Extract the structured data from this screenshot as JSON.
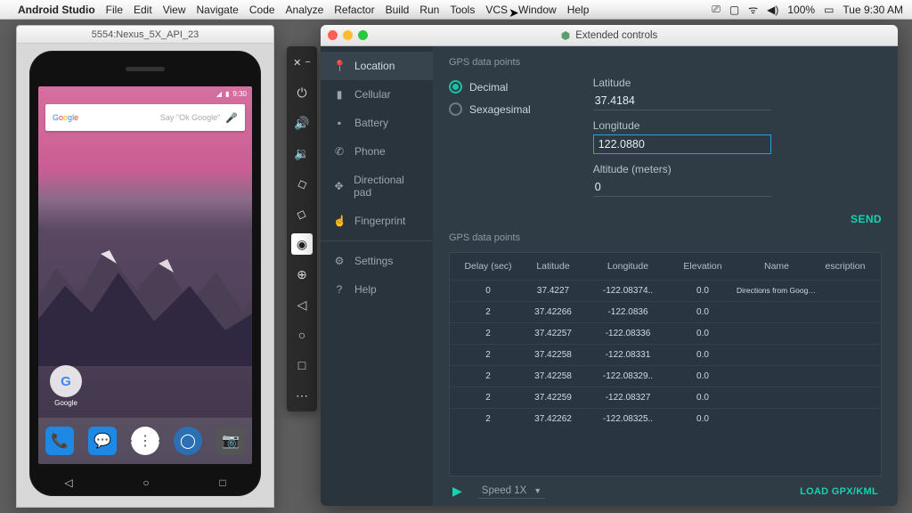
{
  "menubar": {
    "app": "Android Studio",
    "items": [
      "File",
      "Edit",
      "View",
      "Navigate",
      "Code",
      "Analyze",
      "Refactor",
      "Build",
      "Run",
      "Tools",
      "VCS",
      "Window",
      "Help"
    ],
    "battery": "100%",
    "clock": "Tue 9:30 AM"
  },
  "emulator": {
    "title": "5554:Nexus_5X_API_23",
    "status_time": "9:30",
    "search_logo": "Google",
    "search_placeholder": "Say \"Ok Google\"",
    "folder_label": "Google"
  },
  "toolbar_icons": [
    "close-minimize",
    "power",
    "volume-up",
    "volume-down",
    "rotate-left",
    "rotate-right",
    "camera",
    "zoom",
    "back",
    "home",
    "overview",
    "more"
  ],
  "ext": {
    "title": "Extended controls",
    "nav": [
      {
        "icon": "📍",
        "label": "Location",
        "selected": true
      },
      {
        "icon": "▮",
        "label": "Cellular"
      },
      {
        "icon": "▪",
        "label": "Battery"
      },
      {
        "icon": "✆",
        "label": "Phone"
      },
      {
        "icon": "✥",
        "label": "Directional pad"
      },
      {
        "icon": "☝",
        "label": "Fingerprint"
      },
      {
        "sep": true
      },
      {
        "icon": "⚙",
        "label": "Settings"
      },
      {
        "icon": "?",
        "label": "Help"
      }
    ],
    "section1": "GPS data points",
    "radio_decimal": "Decimal",
    "radio_sexagesimal": "Sexagesimal",
    "lat_label": "Latitude",
    "lat_value": "37.4184",
    "lon_label": "Longitude",
    "lon_value": "122.0880",
    "alt_label": "Altitude (meters)",
    "alt_value": "0",
    "send": "SEND",
    "section2": "GPS data points",
    "cols": [
      "Delay (sec)",
      "Latitude",
      "Longitude",
      "Elevation",
      "Name",
      "escription"
    ],
    "rows": [
      {
        "d": "0",
        "lat": "37.4227",
        "lon": "-122.08374..",
        "e": "0.0",
        "n": "Directions from Google..",
        "ds": ""
      },
      {
        "d": "2",
        "lat": "37.42266",
        "lon": "-122.0836",
        "e": "0.0",
        "n": "",
        "ds": ""
      },
      {
        "d": "2",
        "lat": "37.42257",
        "lon": "-122.08336",
        "e": "0.0",
        "n": "",
        "ds": ""
      },
      {
        "d": "2",
        "lat": "37.42258",
        "lon": "-122.08331",
        "e": "0.0",
        "n": "",
        "ds": ""
      },
      {
        "d": "2",
        "lat": "37.42258",
        "lon": "-122.08329..",
        "e": "0.0",
        "n": "",
        "ds": ""
      },
      {
        "d": "2",
        "lat": "37.42259",
        "lon": "-122.08327",
        "e": "0.0",
        "n": "",
        "ds": ""
      },
      {
        "d": "2",
        "lat": "37.42262",
        "lon": "-122.08325..",
        "e": "0.0",
        "n": "",
        "ds": ""
      }
    ],
    "speed_label": "Speed 1X",
    "load": "LOAD GPX/KML"
  }
}
